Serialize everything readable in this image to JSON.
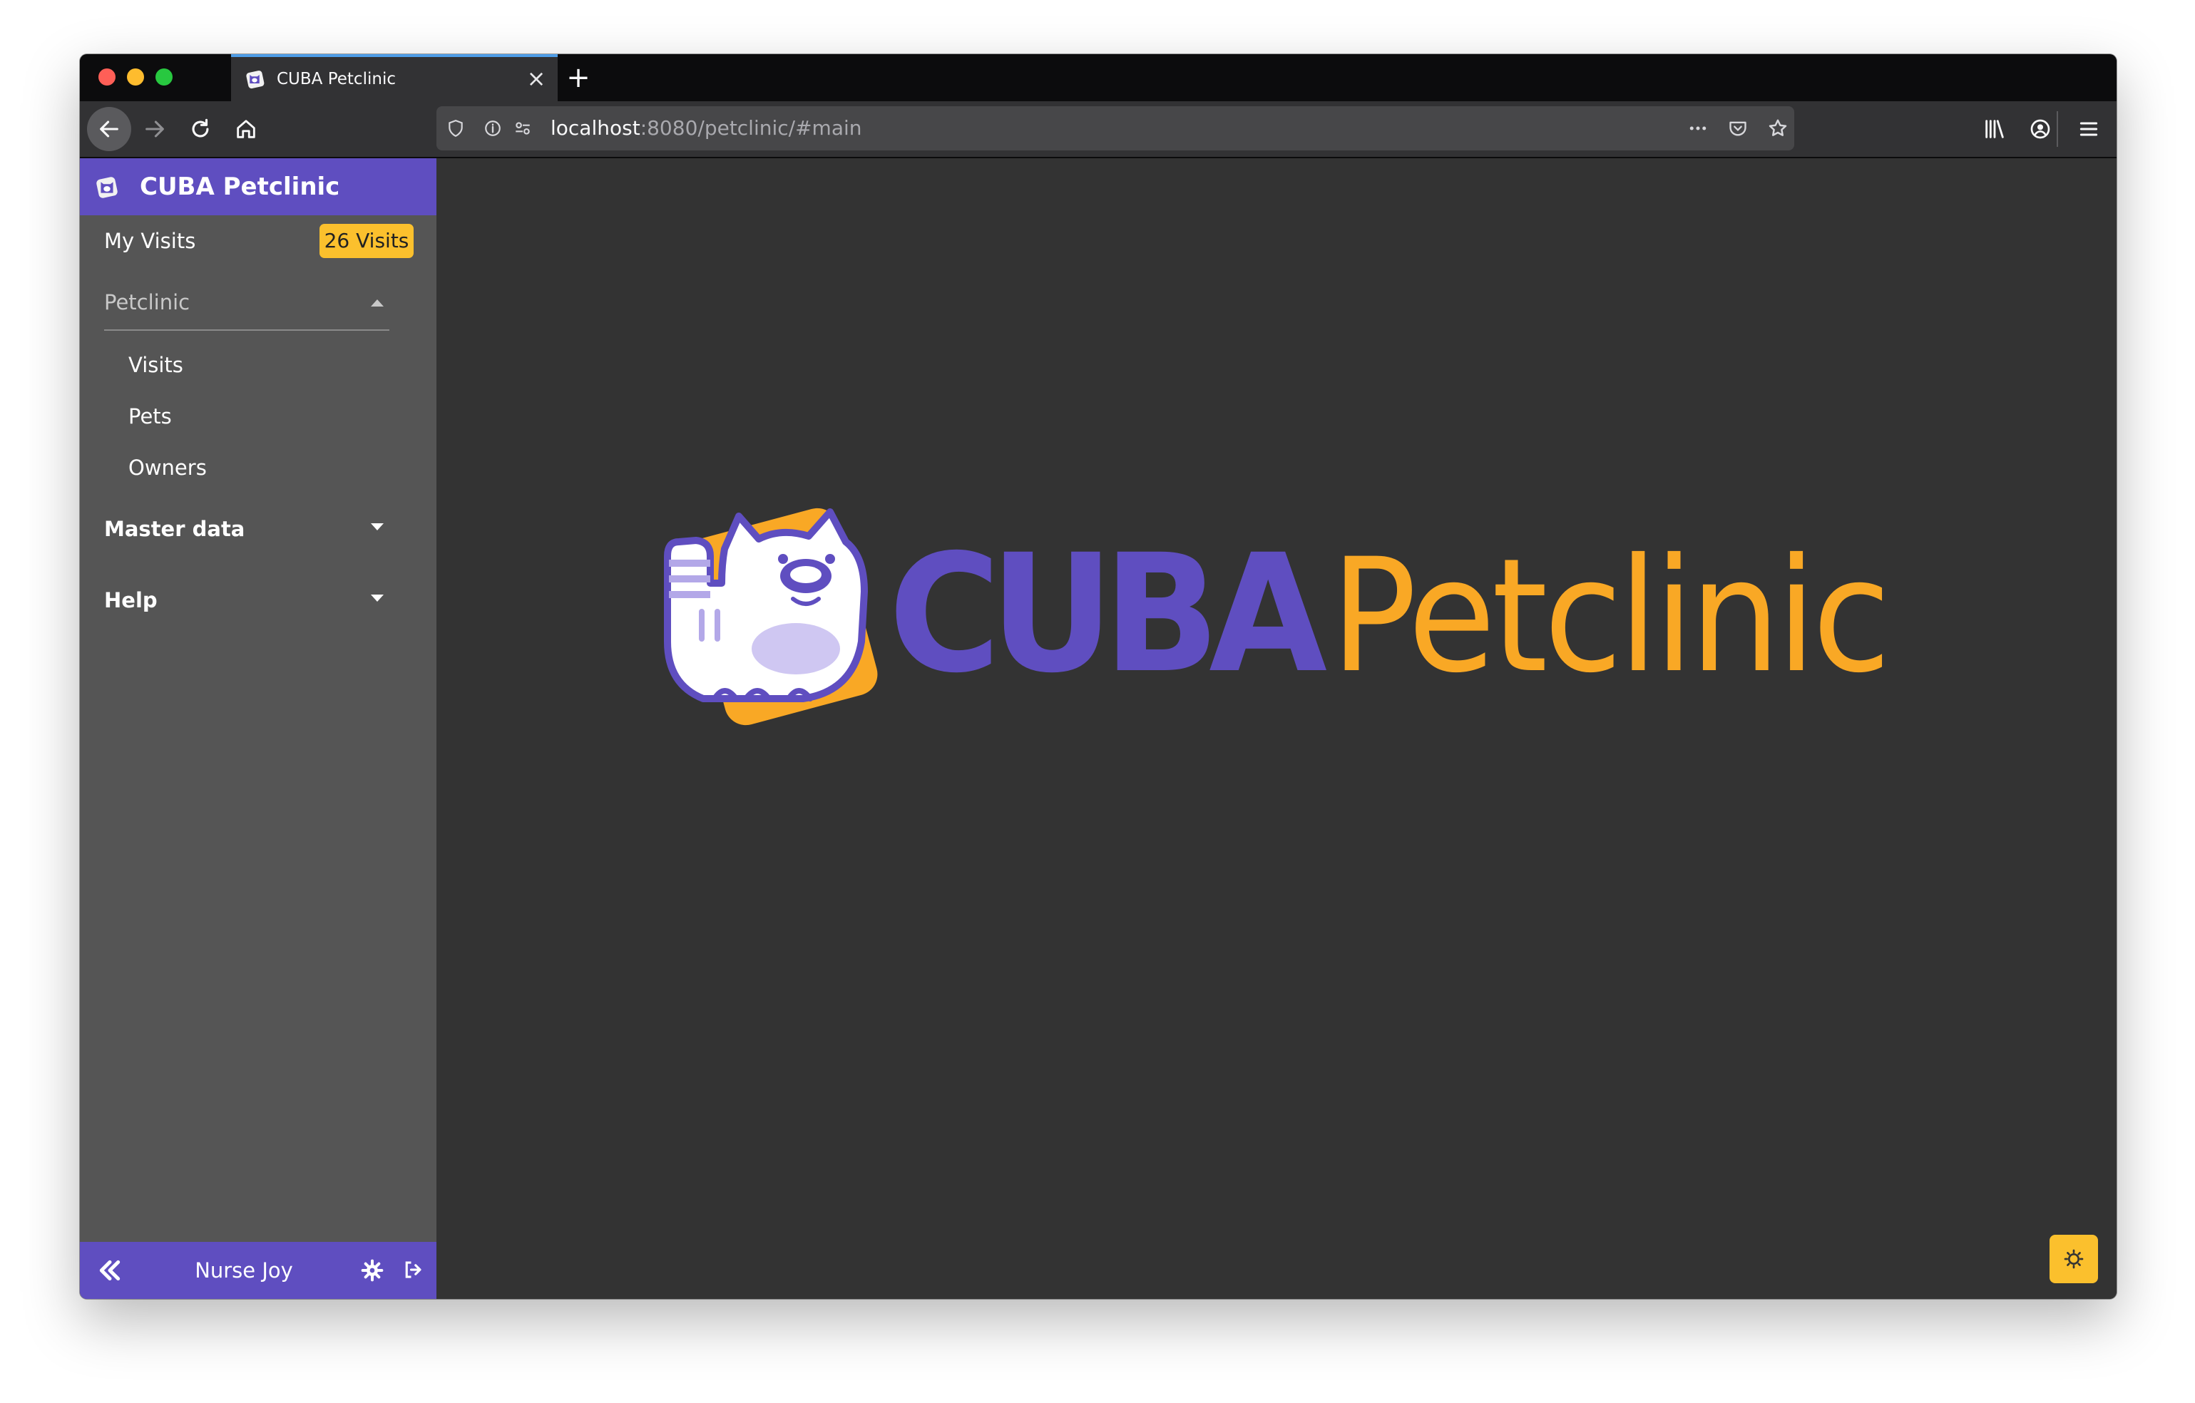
{
  "browser": {
    "tab_title": "CUBA Petclinic",
    "url_host": "localhost",
    "url_rest": ":8080/petclinic/#main",
    "icons": [
      "back-icon",
      "forward-icon",
      "reload-icon",
      "home-icon",
      "shield-icon",
      "info-icon",
      "permissions-icon",
      "more-icon",
      "pocket-icon",
      "bookmark-star-icon",
      "library-icon",
      "account-icon",
      "hamburger-menu-icon"
    ]
  },
  "app": {
    "title": "CUBA Petclinic",
    "logo_word1": "CUBA",
    "logo_word2": "Petclinic"
  },
  "sidebar": {
    "my_visits": "My Visits",
    "visits_badge": "26 Visits",
    "groups": [
      {
        "label": "Petclinic",
        "expanded": true,
        "items": [
          "Visits",
          "Pets",
          "Owners"
        ]
      },
      {
        "label": "Master data",
        "expanded": false
      },
      {
        "label": "Help",
        "expanded": false
      }
    ]
  },
  "user": {
    "name": "Nurse Joy"
  },
  "colors": {
    "brand_purple": "#5f4ec0",
    "accent_yellow": "#fbc02d",
    "sidebar_bg": "#555555",
    "content_bg": "#333333"
  }
}
